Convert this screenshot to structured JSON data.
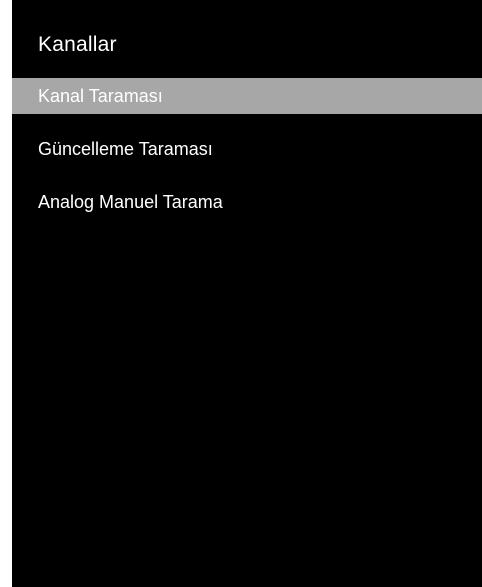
{
  "menu": {
    "title": "Kanallar",
    "items": [
      {
        "label": "Kanal Taraması",
        "selected": true
      },
      {
        "label": "Güncelleme Taraması",
        "selected": false
      },
      {
        "label": "Analog Manuel Tarama",
        "selected": false
      }
    ]
  },
  "colors": {
    "panel_background": "#000000",
    "text": "#ffffff",
    "selection_highlight": "#a7a7a7",
    "page_background": "#ffffff"
  }
}
